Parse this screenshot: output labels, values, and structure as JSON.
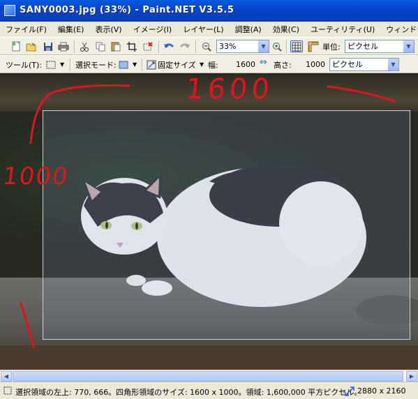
{
  "window": {
    "title": "SANY0003.jpg (33%) - Paint.NET V3.5.5"
  },
  "menu": [
    "ファイル(F)",
    "編集(E)",
    "表示(V)",
    "イメージ(I)",
    "レイヤー(L)",
    "調整(A)",
    "効果(C)",
    "ユーティリティ(U)",
    "ウィンドウ(W)"
  ],
  "toolbar": {
    "zoom_value": "33%",
    "unit_label": "単位:",
    "unit_value": "ピクセル"
  },
  "tool_options": {
    "tool_label": "ツール(T):",
    "selection_mode_label": "選択モード:",
    "fixed_size_label": "固定サイズ",
    "width_label": "幅:",
    "width_value": "1600",
    "height_label": "高さ:",
    "height_value": "1000",
    "unit_value": "ピクセル"
  },
  "annotations": {
    "width_note": "1600",
    "height_note": "1000"
  },
  "status": {
    "selection_info": "選択領域の左上: 770, 666。四角形領域のサイズ: 1600 x 1000。領域: 1,600,000 平方ピクセル。",
    "image_size": "2880 x 2160"
  },
  "colors": {
    "titlebar": "#0a50d8",
    "annotation_red": "#e0141c",
    "selection_border": "#c9d2e6"
  },
  "icons": [
    "new-image-icon",
    "open-icon",
    "save-icon",
    "print-icon",
    "cut-icon",
    "copy-icon",
    "paste-icon",
    "crop-icon",
    "deselect-icon",
    "undo-icon",
    "redo-icon",
    "zoom-out-icon",
    "zoom-in-icon",
    "grid-icon",
    "ruler-icon"
  ]
}
